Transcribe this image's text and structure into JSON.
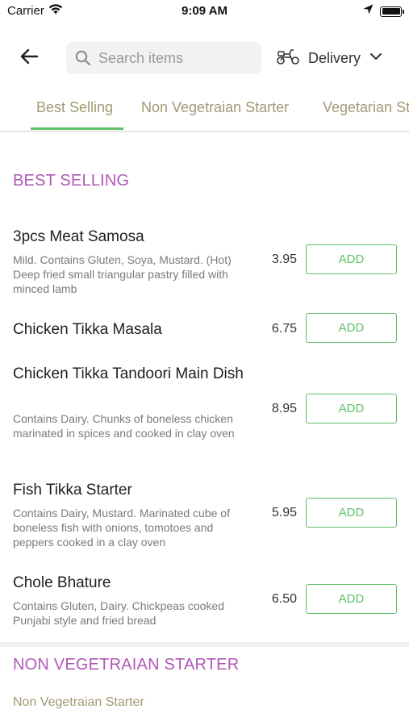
{
  "status_bar": {
    "carrier": "Carrier",
    "time": "9:09 AM"
  },
  "header": {
    "search_placeholder": "Search items",
    "delivery_label": "Delivery"
  },
  "tabs": [
    {
      "label": "Best Selling",
      "active": true
    },
    {
      "label": "Non Vegetraian Starter",
      "active": false
    },
    {
      "label": "Vegetarian Starter",
      "active": false
    }
  ],
  "sections": [
    {
      "title": "BEST SELLING",
      "items": [
        {
          "name": "3pcs Meat Samosa",
          "description": "Mild. Contains Gluten, Soya, Mustard. (Hot) Deep fried small triangular pastry filled with minced lamb",
          "price": "3.95",
          "button": "ADD"
        },
        {
          "name": "Chicken Tikka Masala",
          "description": "",
          "price": "6.75",
          "button": "ADD"
        },
        {
          "name": "Chicken Tikka Tandoori Main Dish",
          "description": "Contains Dairy. Chunks of boneless chicken marinated in spices and cooked in clay oven",
          "price": "8.95",
          "button": "ADD"
        },
        {
          "name": "Fish Tikka Starter",
          "description": "Contains Dairy, Mustard. Marinated cube of boneless fish with onions, tomotoes and peppers cooked in a clay oven",
          "price": "5.95",
          "button": "ADD"
        },
        {
          "name": "Chole Bhature",
          "description": "Contains Gluten, Dairy. Chickpeas cooked Punjabi style and fried bread",
          "price": "6.50",
          "button": "ADD"
        }
      ]
    },
    {
      "title": "NON VEGETRAIAN STARTER",
      "subtitle": "Non Vegetraian Starter"
    }
  ],
  "colors": {
    "accent_green": "#5fbf66",
    "section_purple": "#b058b6",
    "tab_text": "#a09a72"
  }
}
